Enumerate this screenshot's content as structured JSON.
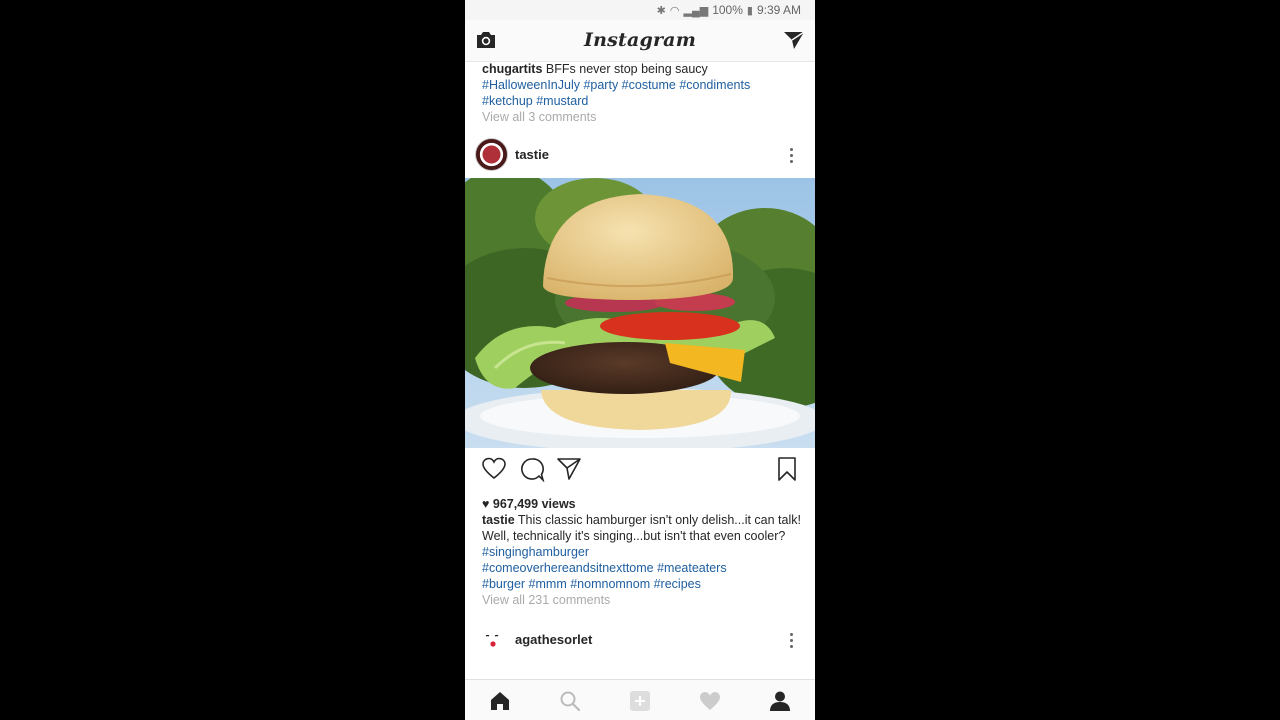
{
  "status_bar": {
    "battery": "100%",
    "time": "9:39 AM",
    "icons": [
      "bluetooth-icon",
      "wifi-icon",
      "signal-icon",
      "battery-icon"
    ]
  },
  "app": {
    "title": "Instagram"
  },
  "prev_post": {
    "username": "chugartits",
    "caption": "BFFs never stop being saucy",
    "hashtags_line1": "#HalloweenInJuly #party #costume #condiments",
    "hashtags_line2": "#ketchup #mustard",
    "comments_link": "View all 3 comments"
  },
  "post": {
    "username": "tastie",
    "likes_icon": "heart-icon",
    "views": "967,499 views",
    "caption_user": "tastie",
    "caption_text": "This classic hamburger isn't only delish...it can talk! Well, technically it's singing...but isn't that even cooler?",
    "caption_tag": "#singinghamburger",
    "hashtags_line2": "#comeoverhereandsitnexttome #meateaters",
    "hashtags_line3": "#burger #mmm #nomnomnom #recipes",
    "comments_link": "View all 231 comments"
  },
  "next_post": {
    "username": "agathesorlet"
  },
  "bottom_nav": [
    "home-icon",
    "search-icon",
    "add-icon",
    "activity-icon",
    "profile-icon"
  ],
  "colors": {
    "hashtag": "#1f5fa0",
    "muted": "#aaaaaa",
    "text": "#262626"
  }
}
